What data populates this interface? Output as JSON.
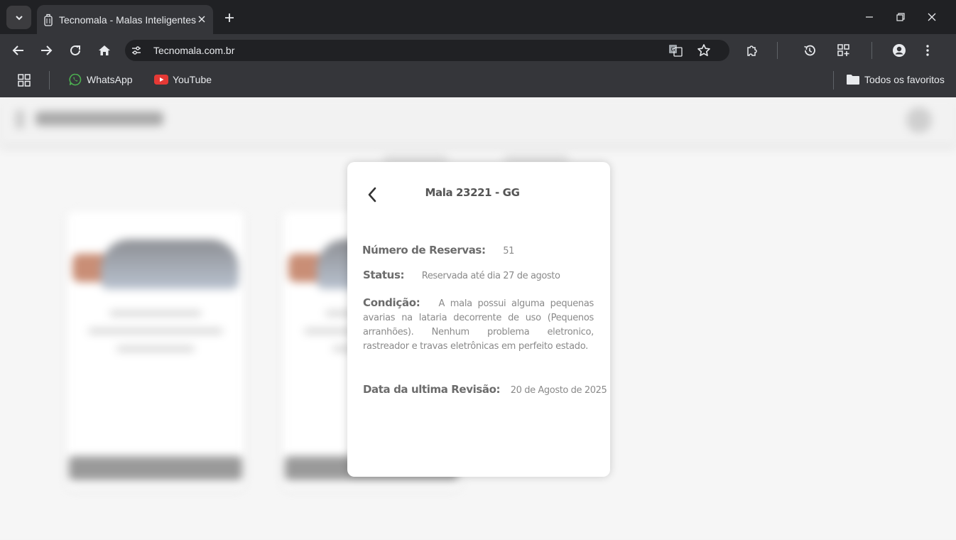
{
  "browser": {
    "tab": {
      "title": "Tecnomala - Malas Inteligentes"
    },
    "address_bar": {
      "url": "Tecnomala.com.br"
    },
    "bookmarks": [
      {
        "label": "WhatsApp",
        "icon": "whatsapp-icon"
      },
      {
        "label": "YouTube",
        "icon": "youtube-icon"
      }
    ],
    "all_bookmarks_label": "Todos os favoritos"
  },
  "modal": {
    "title": "Mala 23221 - GG",
    "reservations": {
      "label": "Número de Reservas:",
      "value": "51"
    },
    "status": {
      "label": "Status:",
      "value": "Reservada até dia 27 de agosto"
    },
    "condition": {
      "label": "Condição:",
      "value": "A mala possui alguma pequenas avarias na lataria decorrente de uso (Pequenos arranhões). Nenhum problema eletronico, rastreador e travas eletrônicas em perfeito estado."
    },
    "last_revision": {
      "label": "Data da ultima Revisão:",
      "value": "20 de Agosto de 2025"
    }
  },
  "colors": {
    "chrome_dark": "#202124",
    "chrome_toolbar": "#35363a",
    "page_bg": "#f6f6f6",
    "modal_bg": "#ffffff",
    "label_text": "#6c6c6c",
    "value_text": "#8a8a8a"
  }
}
